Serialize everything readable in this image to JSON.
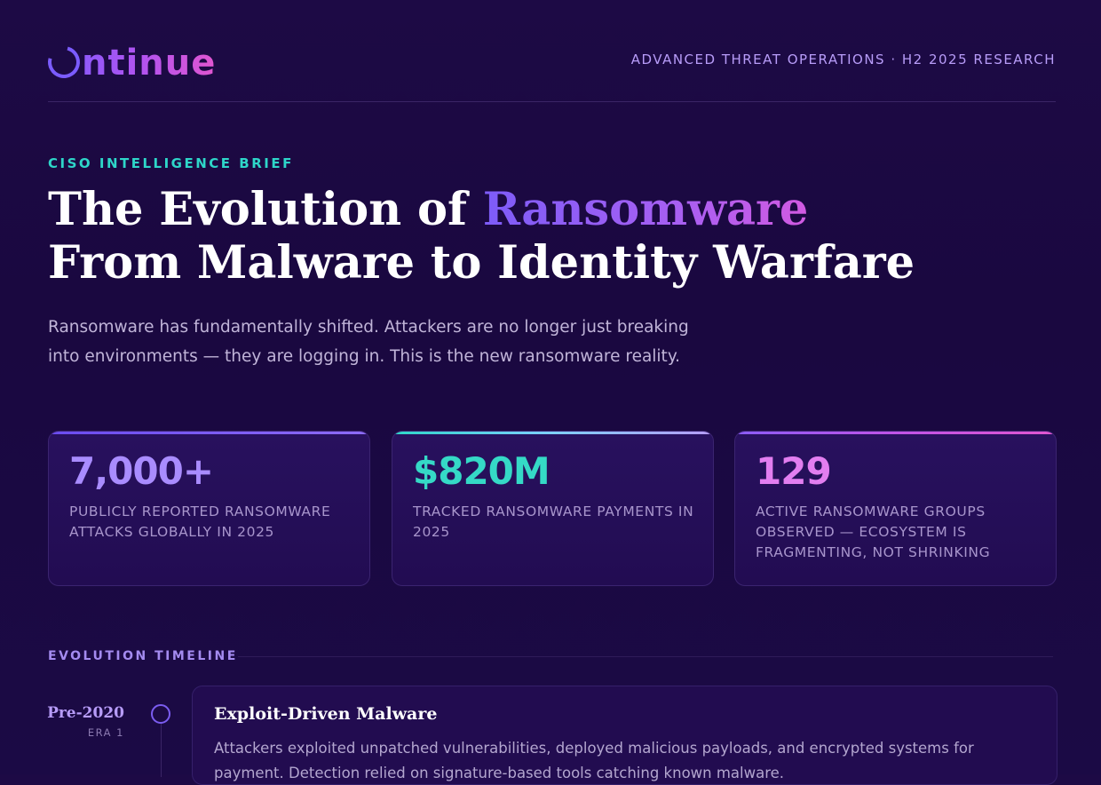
{
  "header": {
    "logo_text": "ntinue",
    "logo_alt": "Ontinue",
    "tagline": "ADVANCED THREAT OPERATIONS · H2 2025 RESEARCH"
  },
  "hero": {
    "kicker": "CISO INTELLIGENCE BRIEF",
    "title_part1": "The Evolution of ",
    "title_accent": "Ransomware",
    "title_line2": "From Malware to Identity Warfare",
    "lede": "Ransomware has fundamentally shifted. Attackers are no longer just breaking into environments — they are logging in. This is the new ransomware reality."
  },
  "stats": [
    {
      "value": "7,000+",
      "label": "PUBLICLY REPORTED RANSOMWARE ATTACKS GLOBALLY IN 2025",
      "color": "#a98cff"
    },
    {
      "value": "$820M",
      "label": "TRACKED RANSOMWARE PAYMENTS IN 2025",
      "color": "#35d9c6"
    },
    {
      "value": "129",
      "label": "ACTIVE RANSOMWARE GROUPS OBSERVED — ECOSYSTEM IS FRAGMENTING, NOT SHRINKING",
      "color": "#e27ef0"
    }
  ],
  "timeline": {
    "heading": "EVOLUTION TIMELINE",
    "eras": [
      {
        "year": "Pre-2020",
        "era": "ERA 1",
        "title": "Exploit-Driven Malware",
        "body": "Attackers exploited unpatched vulnerabilities, deployed malicious payloads, and encrypted systems for payment. Detection relied on signature-based tools catching known malware."
      }
    ]
  }
}
